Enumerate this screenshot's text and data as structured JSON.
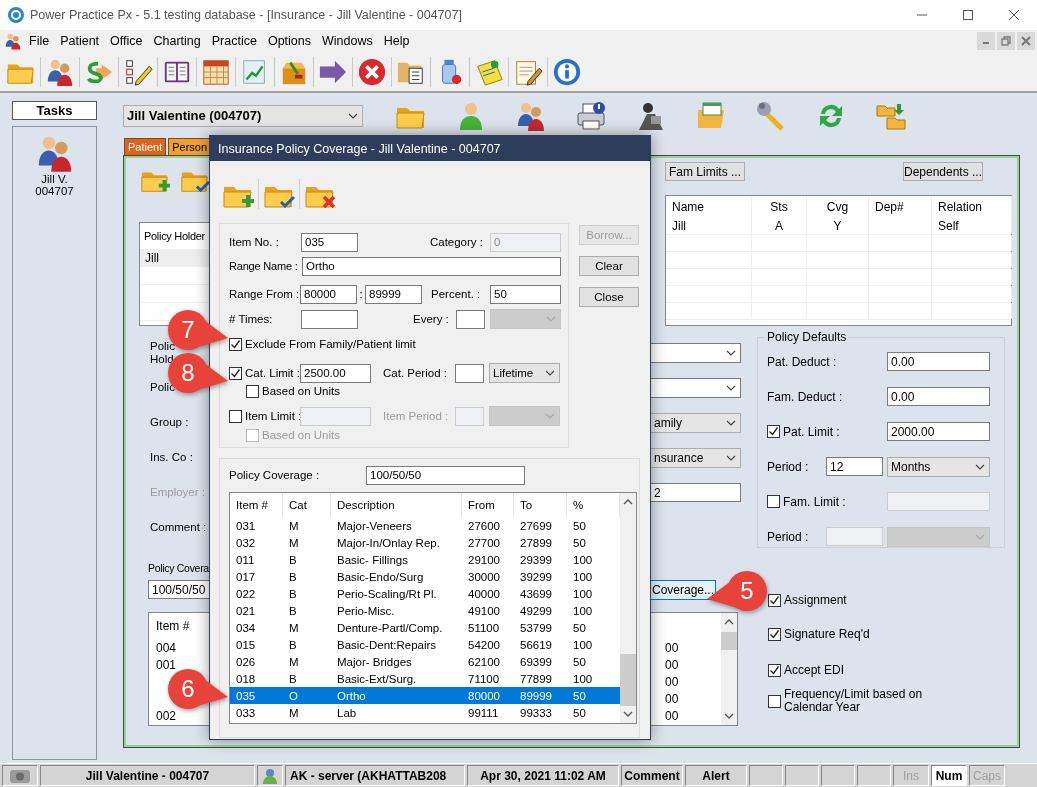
{
  "window": {
    "title": "Power Practice Px - 5.1 testing database - [Insurance - Jill Valentine - 004707]"
  },
  "menu": [
    "File",
    "Patient",
    "Office",
    "Charting",
    "Practice",
    "Options",
    "Windows",
    "Help"
  ],
  "tasks": {
    "title": "Tasks",
    "patient_name": "Jill V.",
    "patient_id": "004707"
  },
  "patient_selector": {
    "value": "Jill Valentine (004707)"
  },
  "tabs": [
    {
      "label": "Patient",
      "selected": true
    },
    {
      "label": "Person",
      "selected": false
    }
  ],
  "fam_limits_button": "Fam Limits ...",
  "dependents_button": "Dependents ...",
  "policy_holders": {
    "header": "Policy Holder",
    "rows": [
      {
        "name": "Jill",
        "selected": true
      }
    ]
  },
  "dependents": {
    "columns": [
      "Name",
      "Sts",
      "Cvg",
      "Dep#",
      "Relation"
    ],
    "rows": [
      {
        "name": "Jill",
        "sts": "A",
        "cvg": "Y",
        "relation": "Self"
      }
    ]
  },
  "policy_fields": [
    {
      "label": "Polic",
      "label_line_2": "Hold",
      "kind": "combo",
      "disabled": false
    },
    {
      "label": "Polic",
      "kind": "combo",
      "disabled": false
    },
    {
      "label": "Group :",
      "kind": "dropdown",
      "value": "amily",
      "disabled": false
    },
    {
      "label": "Ins. Co :",
      "kind": "dropdown",
      "value": "nsurance",
      "disabled": false
    },
    {
      "label": "Employer :",
      "kind": "field",
      "value": "2",
      "disabled": true
    },
    {
      "label": "Comment :",
      "kind": "label",
      "disabled": false
    }
  ],
  "policy_defaults": {
    "title": "Policy Defaults",
    "rows": [
      {
        "kind": "field",
        "label": "Pat. Deduct :",
        "value": "0.00",
        "disabled": false
      },
      {
        "kind": "field",
        "label": "Fam. Deduct :",
        "value": "0.00",
        "disabled": false
      },
      {
        "kind": "check_field",
        "label": "Pat. Limit :",
        "checked": true,
        "value": "2000.00",
        "disabled": false
      },
      {
        "kind": "period",
        "label": "Period :",
        "number": "12",
        "unit": "Months",
        "disabled": false
      },
      {
        "kind": "check_field",
        "label": "Fam. Limit :",
        "checked": false,
        "disabled": true
      },
      {
        "kind": "period",
        "label": "Period :",
        "disabled": true
      }
    ]
  },
  "policy_coverage": {
    "label": "Policy Covera",
    "value": "100/50/50",
    "button": {
      "label": "Coverage...",
      "focused": true
    },
    "list": {
      "header": "Item #",
      "rows": [
        {
          "item": "004",
          "column_2": "00"
        },
        {
          "item": "001",
          "column_2": "00"
        },
        {
          "column_2": "00"
        },
        {
          "column_2": "00"
        },
        {
          "item": "002",
          "column_2": "00"
        }
      ]
    }
  },
  "options": [
    {
      "label": "Assignment",
      "checked": true
    },
    {
      "label": "Signature Req'd",
      "checked": true
    },
    {
      "label": "Accept EDI",
      "checked": true
    },
    {
      "label": "Frequency/Limit based on Calendar Year",
      "checked": false
    }
  ],
  "status_bar": {
    "patient": "Jill Valentine - 004707",
    "user": "AK - server (AKHATTAB208",
    "datetime": "Apr 30, 2021 11:02 AM",
    "panels": [
      "Comment",
      "Alert"
    ],
    "keys": [
      {
        "label": "Ins",
        "on": false
      },
      {
        "label": "Num",
        "on": true
      },
      {
        "label": "Caps",
        "on": false
      }
    ]
  },
  "dialog": {
    "title": "Insurance Policy Coverage - Jill Valentine - 004707",
    "item_no": {
      "label": "Item No. :",
      "value": "035"
    },
    "category": {
      "label": "Category :",
      "value": "0",
      "disabled": true
    },
    "range_name": {
      "label": "Range Name :",
      "value": "Ortho"
    },
    "range": {
      "label": "Range From :",
      "from": "80000",
      "separator": ":",
      "to": "89999"
    },
    "percent": {
      "label": "Percent. :",
      "value": "50"
    },
    "times": {
      "label": "# Times:"
    },
    "every": {
      "label": "Every :",
      "disabled": true
    },
    "exclude": {
      "label": "Exclude From Family/Patient limit",
      "checked": true
    },
    "limits": [
      {
        "label": "Cat. Limit :",
        "checked": true,
        "value": "2500.00",
        "disabled": false,
        "period_label": "Cat. Period :",
        "period_unit": "Lifetime",
        "units_label": "Based on Units",
        "units_checked": false
      },
      {
        "label": "Item Limit :",
        "checked": false,
        "disabled": true,
        "period_label": "Item Period :",
        "units_label": "Based on Units",
        "units_checked": false
      }
    ],
    "buttons": [
      {
        "label": "Borrow...",
        "disabled": true
      },
      {
        "label": "Clear",
        "disabled": false
      },
      {
        "label": "Close",
        "disabled": false
      }
    ],
    "coverage": {
      "label": "Policy Coverage :",
      "value": "100/50/50"
    },
    "table": {
      "columns": [
        "Item #",
        "Cat",
        "Description",
        "From",
        "To",
        "%"
      ],
      "rows": [
        {
          "cells": [
            "031",
            "M",
            "Major-Veneers",
            "27600",
            "27699",
            "50"
          ],
          "selected": false
        },
        {
          "cells": [
            "032",
            "M",
            "Major-In/Onlay Rep.",
            "27700",
            "27899",
            "50"
          ],
          "selected": false
        },
        {
          "cells": [
            "011",
            "B",
            "Basic- Fillings",
            "29100",
            "29399",
            "100"
          ],
          "selected": false
        },
        {
          "cells": [
            "017",
            "B",
            "Basic-Endo/Surg",
            "30000",
            "39299",
            "100"
          ],
          "selected": false
        },
        {
          "cells": [
            "022",
            "B",
            "Perio-Scaling/Rt Pl.",
            "40000",
            "43699",
            "100"
          ],
          "selected": false
        },
        {
          "cells": [
            "021",
            "B",
            "Perio-Misc.",
            "49100",
            "49299",
            "100"
          ],
          "selected": false
        },
        {
          "cells": [
            "034",
            "M",
            "Denture-Partl/Comp.",
            "51100",
            "53799",
            "50"
          ],
          "selected": false
        },
        {
          "cells": [
            "015",
            "B",
            "Basic-Dent:Repairs",
            "54200",
            "56619",
            "100"
          ],
          "selected": false
        },
        {
          "cells": [
            "026",
            "M",
            "Major- Bridges",
            "62100",
            "69399",
            "50"
          ],
          "selected": false
        },
        {
          "cells": [
            "018",
            "B",
            "Basic-Ext/Surg.",
            "71100",
            "77899",
            "100"
          ],
          "selected": false
        },
        {
          "cells": [
            "035",
            "O",
            "Ortho",
            "80000",
            "89999",
            "50"
          ],
          "selected": true
        },
        {
          "cells": [
            "033",
            "M",
            "Lab",
            "99111",
            "99333",
            "50"
          ],
          "selected": false
        }
      ]
    }
  },
  "callouts": [
    {
      "number": "7",
      "kind": "right"
    },
    {
      "number": "8",
      "kind": "right"
    },
    {
      "number": "6",
      "kind": "right"
    },
    {
      "number": "5",
      "kind": "left"
    }
  ]
}
